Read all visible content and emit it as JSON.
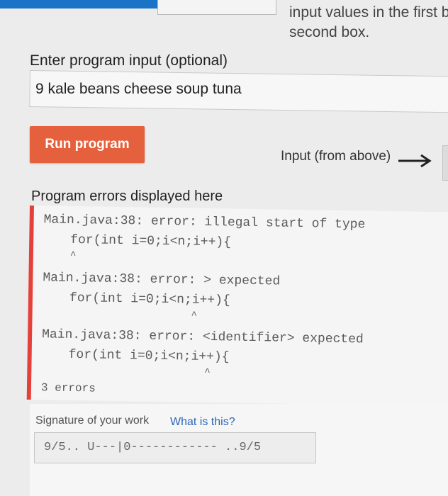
{
  "top": {
    "hint": "input values in the first bo",
    "hint2": "second box."
  },
  "input": {
    "label": "Enter program input (optional)",
    "value": "9 kale beans cheese soup tuna"
  },
  "run": {
    "label": "Run program"
  },
  "flow": {
    "input_label": "Input (from above)",
    "arrow_icon": "right-arrow-icon"
  },
  "errors": {
    "label": "Program errors displayed here",
    "entries": [
      {
        "message": "Main.java:38: error: illegal start of type",
        "code": "for(int i=0;i<n;i++){",
        "caret": "^"
      },
      {
        "message": "Main.java:38: error: > expected",
        "code": "for(int i=0;i<n;i++){",
        "caret": "^"
      },
      {
        "message": "Main.java:38: error: <identifier> expected",
        "code": "for(int i=0;i<n;i++){",
        "caret": "^"
      }
    ],
    "summary": "3 errors"
  },
  "signature": {
    "label": "Signature of your work",
    "link": "What is this?",
    "value": "9/5.. U---|0------------ ..9/5"
  },
  "colors": {
    "accent": "#e5613d",
    "error_bar": "#e5413a",
    "link": "#2a66b5",
    "top_blue": "#1a73c7"
  }
}
